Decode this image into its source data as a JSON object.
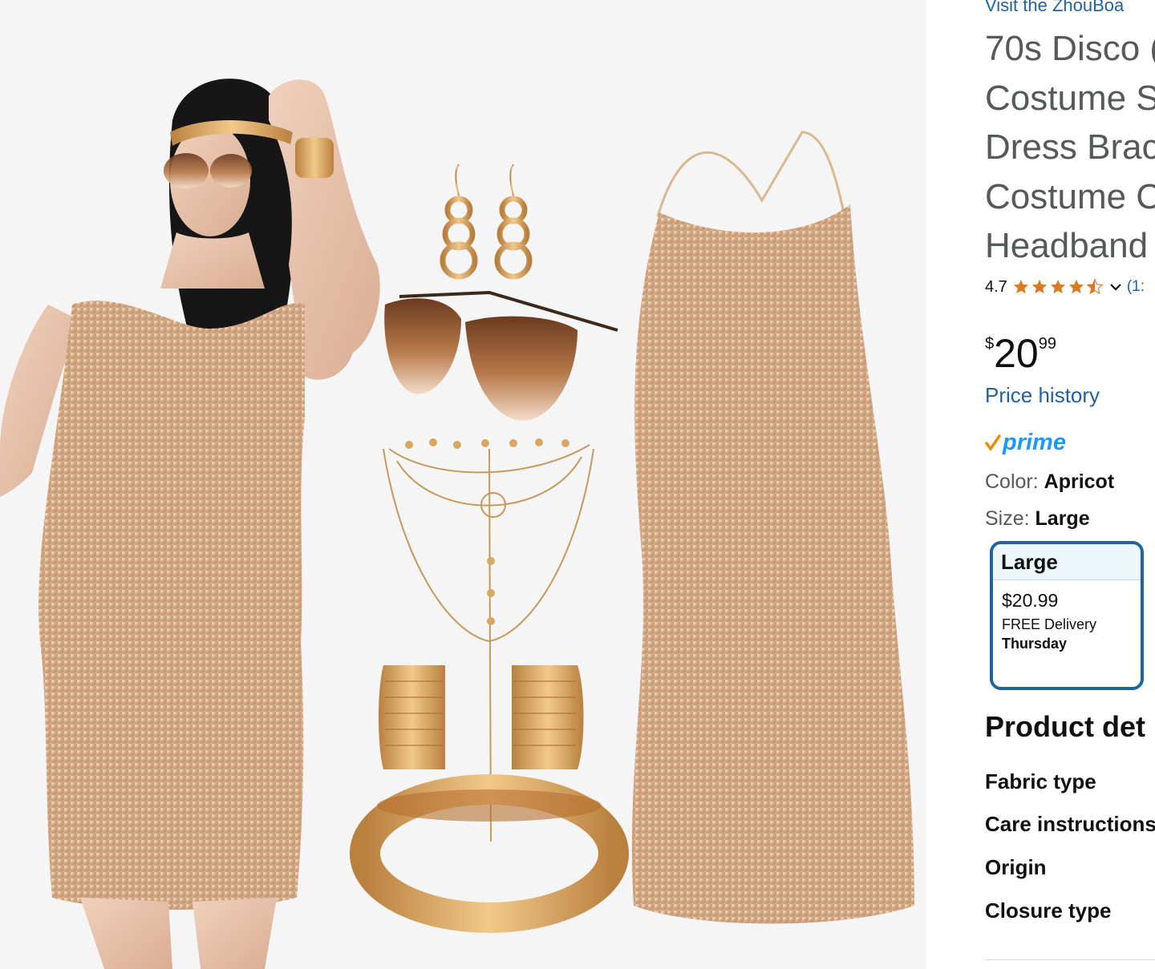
{
  "product_image": {
    "alt": "70s disco costume set with gold sequin dress, earrings, sunglasses, necklace, bracelets and headband"
  },
  "store": {
    "link_text": "Visit the ZhouBoa"
  },
  "title_lines": [
    "70s Disco (",
    "Costume S",
    "Dress Brac",
    "Costume C",
    "Headband"
  ],
  "rating": {
    "value": "4.7",
    "stars": 4.5,
    "count_text": "(1:"
  },
  "price": {
    "symbol": "$",
    "whole": "20",
    "fraction": "99"
  },
  "price_history_label": "Price history",
  "prime_label": "prime",
  "color": {
    "label": "Color: ",
    "value": "Apricot"
  },
  "size": {
    "label": "Size: ",
    "value": "Large"
  },
  "size_option": {
    "name": "Large",
    "price": "$20.99",
    "delivery": "FREE Delivery",
    "day": "Thursday"
  },
  "details": {
    "heading": "Product det",
    "rows": [
      "Fabric type",
      "Care instructions",
      "Origin",
      "Closure type"
    ]
  },
  "colors": {
    "link": "#2162a1",
    "prime": "#1a98ff",
    "star": "#de7921",
    "check": "#f08804",
    "selected_border": "#2162a1"
  }
}
